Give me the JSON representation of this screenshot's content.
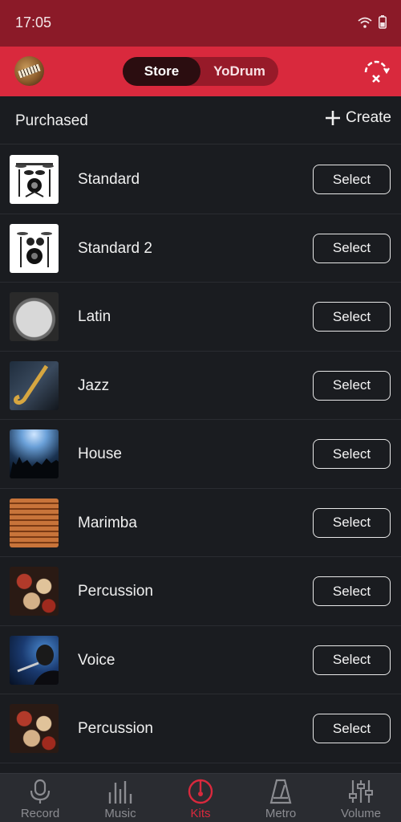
{
  "status": {
    "time": "17:05"
  },
  "header": {
    "tabs": [
      {
        "label": "Store",
        "active": true
      },
      {
        "label": "YoDrum",
        "active": false
      }
    ]
  },
  "section": {
    "title": "Purchased",
    "create_label": "Create"
  },
  "kits": [
    {
      "name": "Standard",
      "thumb": "standard",
      "action": "Select"
    },
    {
      "name": "Standard 2",
      "thumb": "standard",
      "action": "Select"
    },
    {
      "name": "Latin",
      "thumb": "latin",
      "action": "Select"
    },
    {
      "name": "Jazz",
      "thumb": "jazz",
      "action": "Select"
    },
    {
      "name": "House",
      "thumb": "house",
      "action": "Select"
    },
    {
      "name": "Marimba",
      "thumb": "marimba",
      "action": "Select"
    },
    {
      "name": "Percussion",
      "thumb": "perc",
      "action": "Select"
    },
    {
      "name": "Voice",
      "thumb": "voice",
      "action": "Select"
    },
    {
      "name": "Percussion",
      "thumb": "perc",
      "action": "Select"
    }
  ],
  "tabbar": {
    "items": [
      {
        "label": "Record",
        "icon": "microphone-icon"
      },
      {
        "label": "Music",
        "icon": "music-bars-icon"
      },
      {
        "label": "Kits",
        "icon": "drum-icon",
        "active": true
      },
      {
        "label": "Metro",
        "icon": "metronome-icon"
      },
      {
        "label": "Volume",
        "icon": "sliders-icon"
      }
    ]
  },
  "colors": {
    "accent": "#d9293d",
    "status_bar": "#8b1a28",
    "background": "#1a1c20",
    "tabbar": "#2a2c31"
  }
}
